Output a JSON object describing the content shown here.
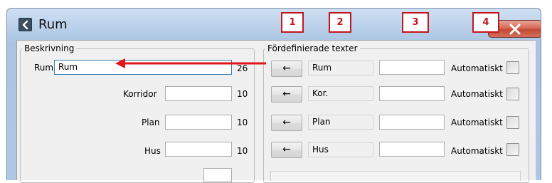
{
  "window": {
    "title": "Rum"
  },
  "beskrivning": {
    "legend": "Beskrivning",
    "rows": [
      {
        "label": "Rum",
        "value": "Rum",
        "max": "26"
      },
      {
        "label": "Korridor",
        "value": "",
        "max": "10"
      },
      {
        "label": "Plan",
        "value": "",
        "max": "10"
      },
      {
        "label": "Hus",
        "value": "",
        "max": "10"
      }
    ]
  },
  "fordefinierade": {
    "legend": "Fördefinierade texter",
    "rows": [
      {
        "button": "←",
        "preset": "Rum",
        "custom": "",
        "auto_label": "Automatiskt",
        "checked": false
      },
      {
        "button": "←",
        "preset": "Kor.",
        "custom": "",
        "auto_label": "Automatiskt",
        "checked": false
      },
      {
        "button": "←",
        "preset": "Plan",
        "custom": "",
        "auto_label": "Automatiskt",
        "checked": false
      },
      {
        "button": "←",
        "preset": "Hus",
        "custom": "",
        "auto_label": "Automatiskt",
        "checked": false
      }
    ]
  },
  "callouts": [
    "1",
    "2",
    "3",
    "4"
  ],
  "colors": {
    "callout": "#c4151c",
    "arrow": "#e0151c",
    "titlebar": "#b9d0ea",
    "close": "#c34a36"
  },
  "icons": {
    "app": "back-arrow-icon",
    "close": "close-icon",
    "annotation": "red-arrow-icon"
  }
}
